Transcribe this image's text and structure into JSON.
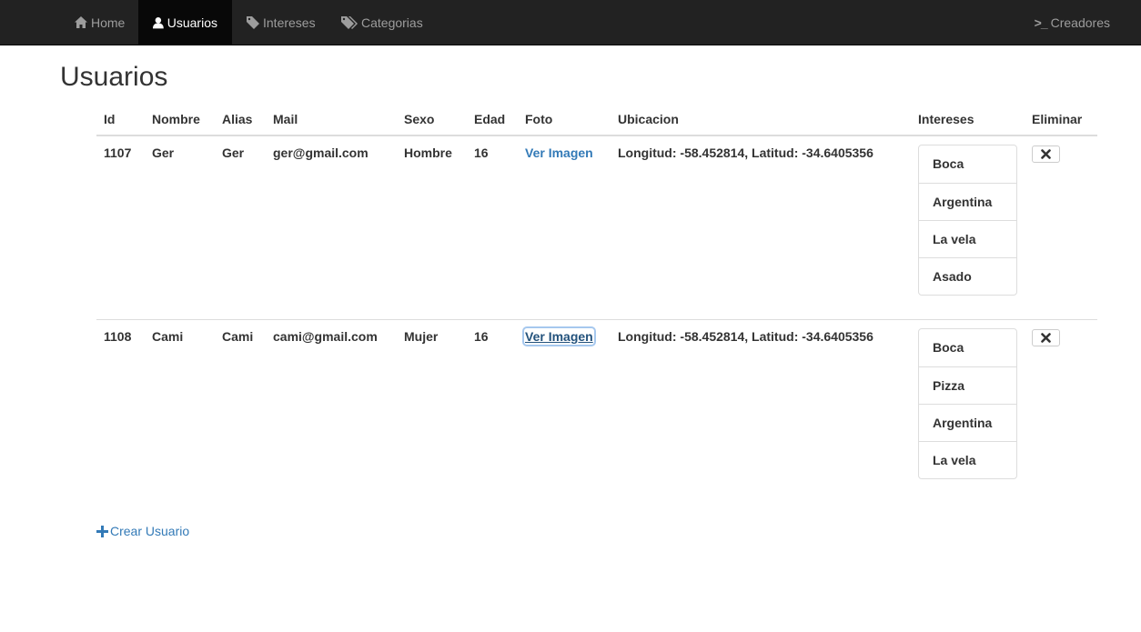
{
  "nav": {
    "home": "Home",
    "usuarios": "Usuarios",
    "intereses": "Intereses",
    "categorias": "Categorias",
    "creadores": "Creadores",
    "creadores_prefix": ">_"
  },
  "page": {
    "title": "Usuarios"
  },
  "table": {
    "headers": {
      "id": "Id",
      "nombre": "Nombre",
      "alias": "Alias",
      "mail": "Mail",
      "sexo": "Sexo",
      "edad": "Edad",
      "foto": "Foto",
      "ubicacion": "Ubicacion",
      "intereses": "Intereses",
      "eliminar": "Eliminar"
    },
    "rows": [
      {
        "id": "1107",
        "nombre": "Ger",
        "alias": "Ger",
        "mail": "ger@gmail.com",
        "sexo": "Hombre",
        "edad": "16",
        "foto": "Ver Imagen",
        "ubicacion": "Longitud: -58.452814, Latitud: -34.6405356",
        "intereses": [
          "Boca",
          "Argentina",
          "La vela",
          "Asado"
        ]
      },
      {
        "id": "1108",
        "nombre": "Cami",
        "alias": "Cami",
        "mail": "cami@gmail.com",
        "sexo": "Mujer",
        "edad": "16",
        "foto": "Ver Imagen",
        "ubicacion": "Longitud: -58.452814, Latitud: -34.6405356",
        "intereses": [
          "Boca",
          "Pizza",
          "Argentina",
          "La vela"
        ]
      }
    ]
  },
  "actions": {
    "crear_usuario": "Crear Usuario"
  },
  "icons": {
    "home": "home-icon",
    "user": "user-icon",
    "tag": "tag-icon",
    "tags": "tags-icon",
    "remove": "remove-icon",
    "plus": "plus-icon"
  },
  "colors": {
    "navbar_bg": "#222222",
    "nav_active_bg": "#080808",
    "link": "#337ab7",
    "text": "#333333"
  }
}
